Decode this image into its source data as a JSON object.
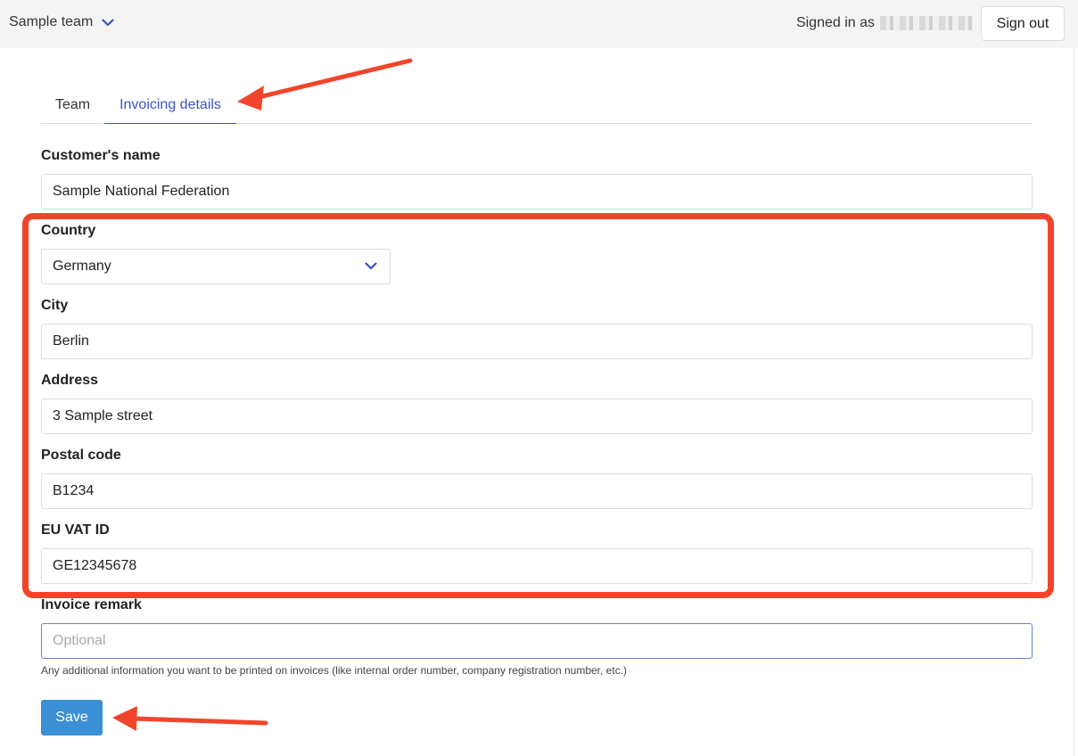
{
  "header": {
    "team_name": "Sample team",
    "signed_in_label": "Signed in as",
    "sign_out_label": "Sign out"
  },
  "tabs": [
    {
      "label": "Team",
      "active": false
    },
    {
      "label": "Invoicing details",
      "active": true
    }
  ],
  "form": {
    "customer_name": {
      "label": "Customer's name",
      "value": "Sample National Federation"
    },
    "country": {
      "label": "Country",
      "value": "Germany"
    },
    "city": {
      "label": "City",
      "value": "Berlin"
    },
    "address": {
      "label": "Address",
      "value": "3 Sample street"
    },
    "postal_code": {
      "label": "Postal code",
      "value": "B1234"
    },
    "vat_id": {
      "label": "EU VAT ID",
      "value": "GE12345678"
    },
    "invoice_remark": {
      "label": "Invoice remark",
      "value": "",
      "placeholder": "Optional",
      "help": "Any additional information you want to be printed on invoices (like internal order number, company registration number, etc.)"
    },
    "save_label": "Save"
  },
  "colors": {
    "accent": "#3a53c9",
    "save_button": "#3b8fd4",
    "annotation": "#f1452b"
  },
  "icons": [
    "chevron-down-icon",
    "annotation-arrow"
  ]
}
